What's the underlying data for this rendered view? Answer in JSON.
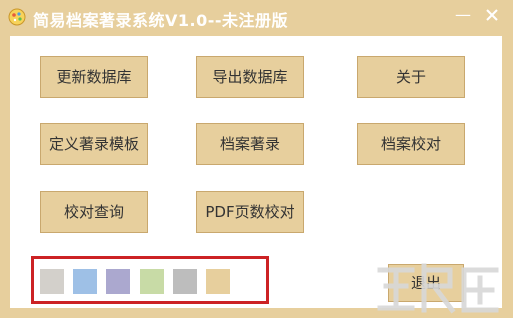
{
  "window": {
    "title": "简易档案著录系统V1.0--未注册版",
    "minimize_glyph": "—",
    "close_glyph": "✕"
  },
  "buttons": {
    "update_db": "更新数据库",
    "export_db": "导出数据库",
    "about": "关于",
    "define_template": "定义著录模板",
    "archive_catalog": "档案著录",
    "archive_check": "档案校对",
    "check_query": "校对查询",
    "pdf_page_check": "PDF页数校对",
    "exit": "退出"
  },
  "theme_swatches": [
    {
      "name": "gray",
      "color": "#d3d0cb"
    },
    {
      "name": "blue",
      "color": "#9ec0e6"
    },
    {
      "name": "purple",
      "color": "#aba8cf"
    },
    {
      "name": "green",
      "color": "#c8dba6"
    },
    {
      "name": "silver",
      "color": "#bdbdbd"
    },
    {
      "name": "tan",
      "color": "#e7cf9d"
    }
  ],
  "colors": {
    "window": "#e7cf9d",
    "client": "#ffffff",
    "button": "#e7cf9d",
    "highlight": "#cc2224"
  },
  "icons": {
    "app": "app-icon",
    "close": "close-icon",
    "watermark": "watermark-logo"
  }
}
